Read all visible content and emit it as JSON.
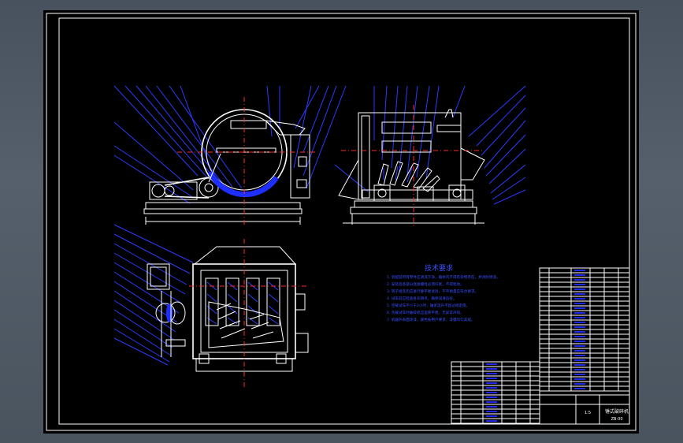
{
  "drawing": {
    "title": "技术要求",
    "requirements": [
      "1. 装配前所有零件应清洗干净，箱体内不得有杂物存在，并涂防锈漆。",
      "2. 安装后各部分连接螺栓必须拧紧，不得松动。",
      "3. 转子组装后应进行静平衡试验，不平衡量应符合要求。",
      "4. 试车前应检查各润滑点，确保润滑良好。",
      "5. 空载试车不少于2小时，轴承温升不超过规定值。",
      "6. 负载试车时破碎机应运转平稳，无异常声响。",
      "7. 机器外表面涂漆，颜色按用户要求，漆膜均匀美观。"
    ],
    "title_block": {
      "name": "锤式破碎机",
      "code": "ZB-00",
      "scale": "1:5"
    },
    "colors": {
      "background": "#000000",
      "outline": "#ffffff",
      "annotation": "#2a3cff",
      "centerline": "#ff2a2a"
    }
  }
}
